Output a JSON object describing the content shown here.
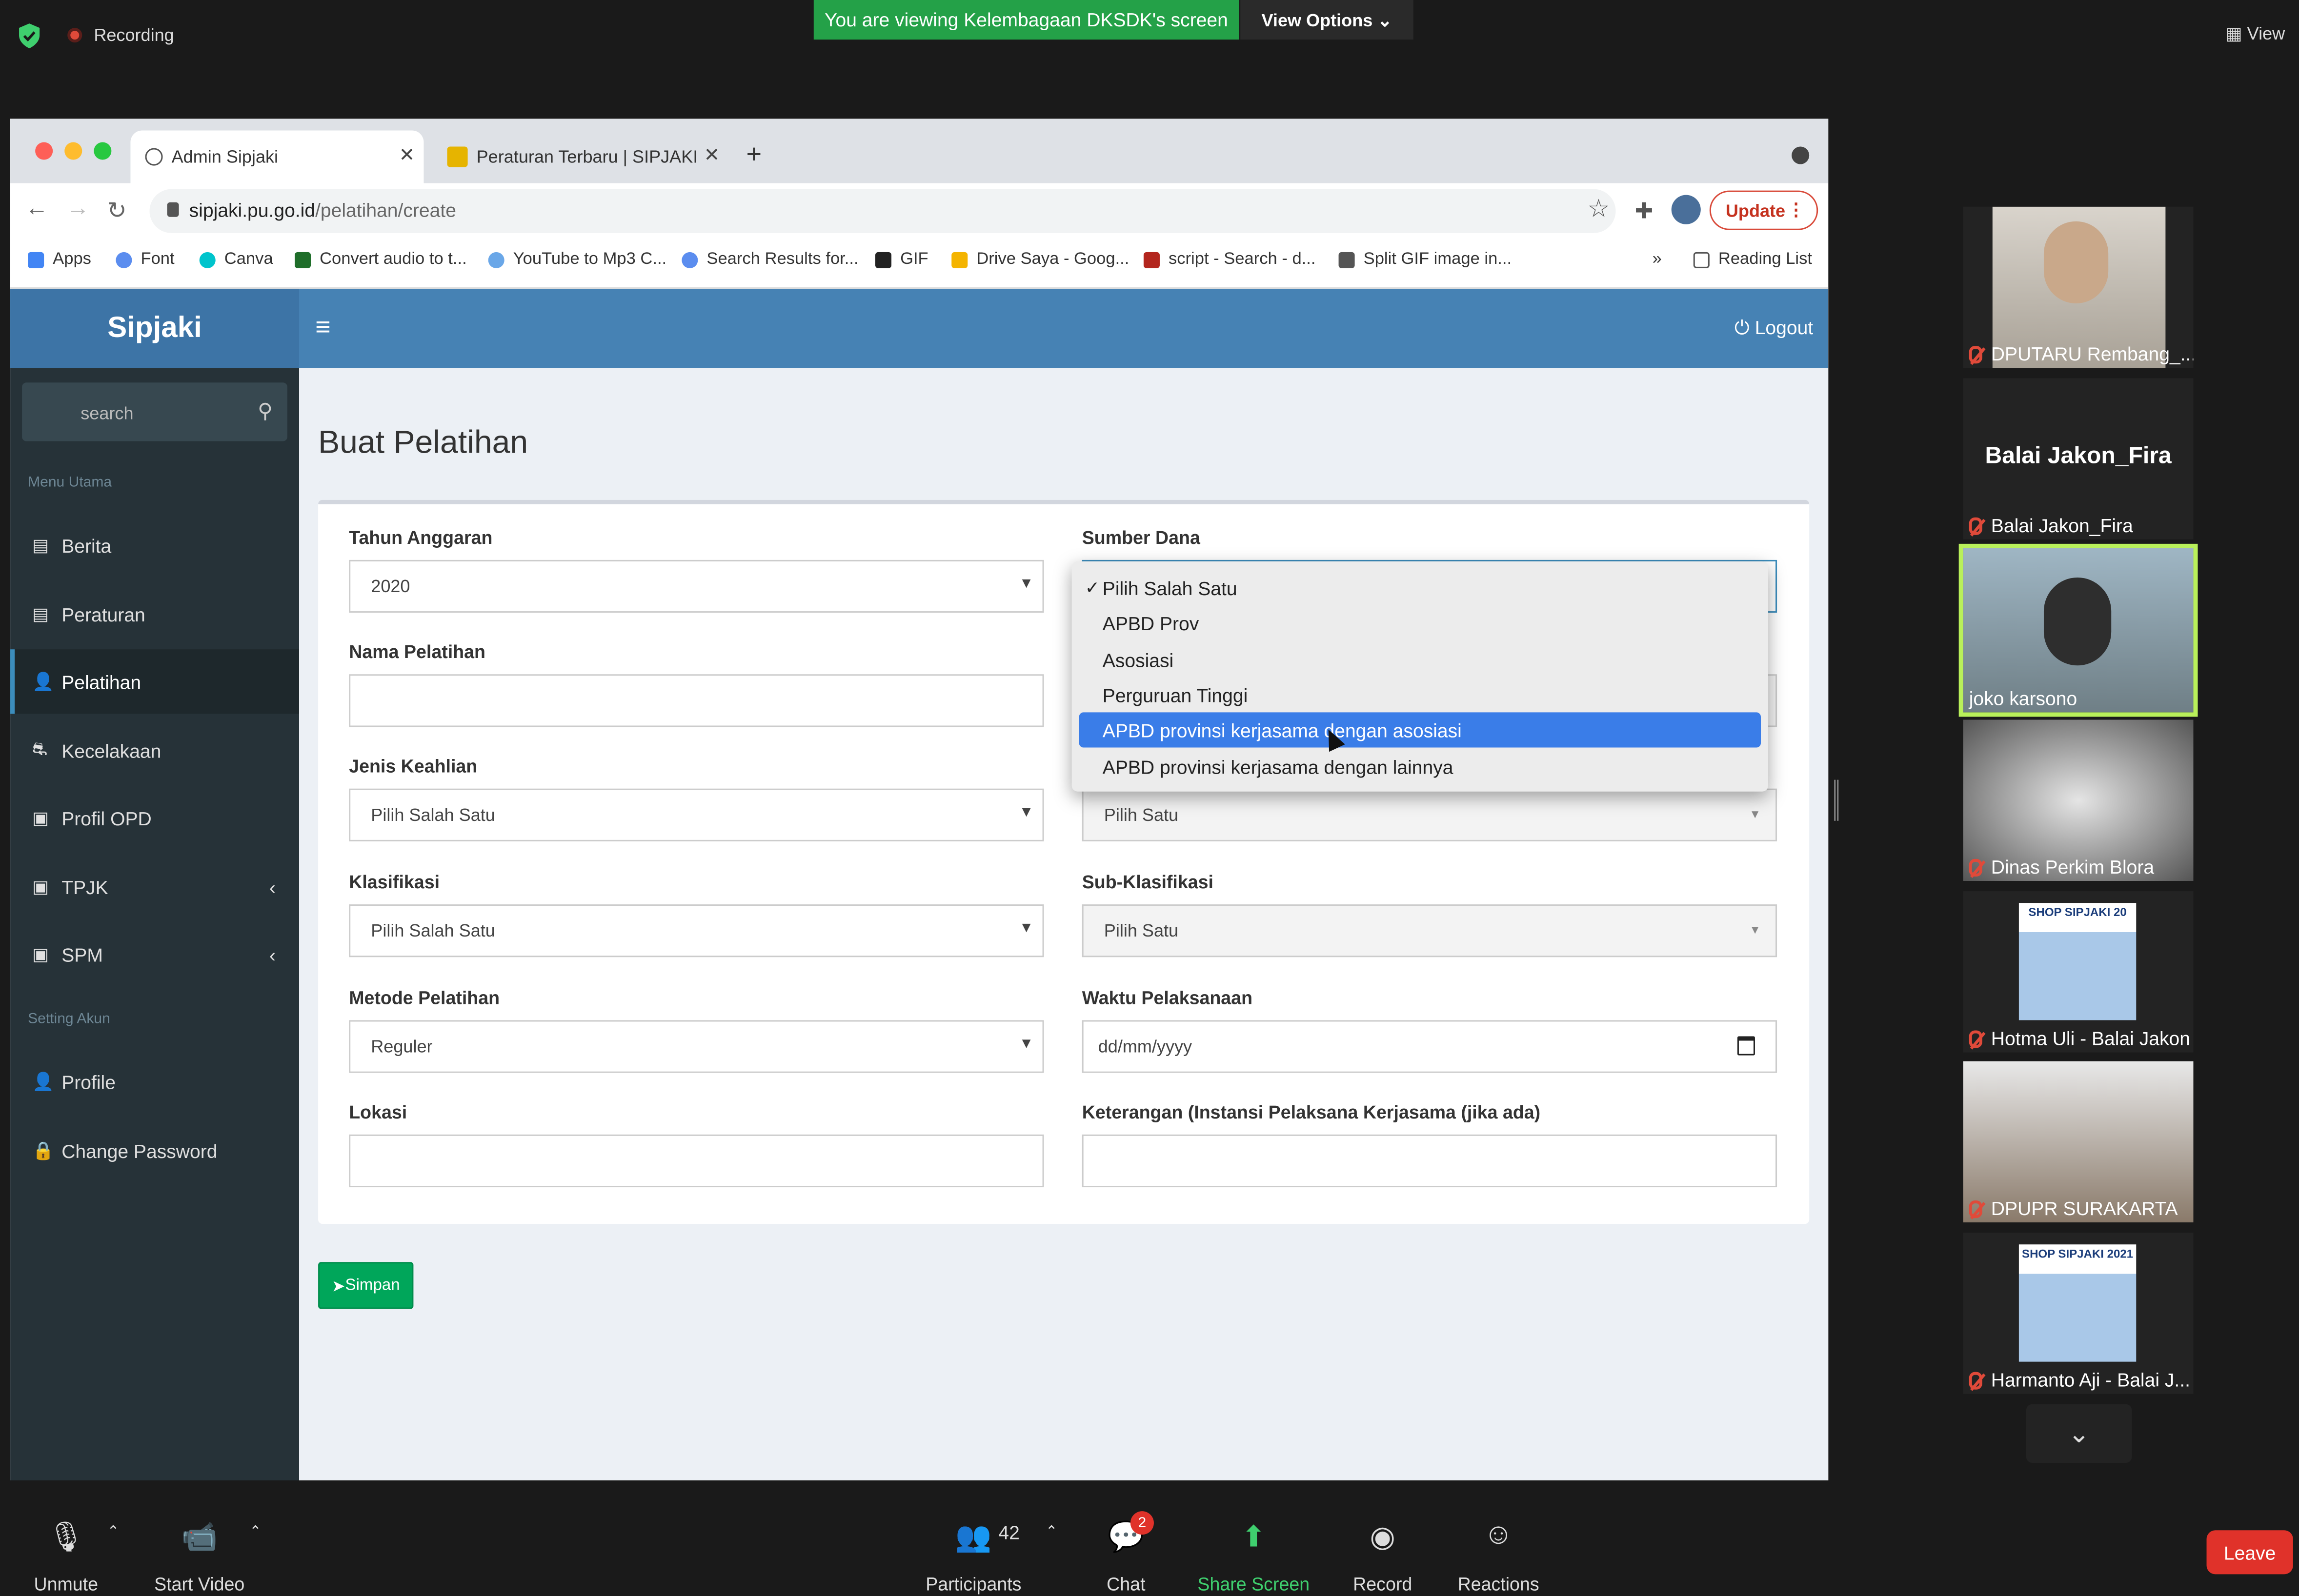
{
  "zoom": {
    "recording_label": "Recording",
    "viewing_banner": "You are viewing Kelembagaan DKSDK's screen",
    "view_options": "View Options ⌄",
    "view_label": "View",
    "participant_count": "42",
    "chat_badge": "2",
    "toolbar": {
      "unmute": "Unmute",
      "start_video": "Start Video",
      "participants": "Participants",
      "chat": "Chat",
      "share_screen": "Share Screen",
      "record": "Record",
      "reactions": "Reactions",
      "leave": "Leave"
    },
    "participants": [
      {
        "name": "DPUTARU Rembang_..."
      },
      {
        "name": "Balai Jakon_Fira",
        "big_name": "Balai Jakon_Fira"
      },
      {
        "name": "joko karsono"
      },
      {
        "name": "Dinas Perkim Blora"
      },
      {
        "name": "Hotma Uli - Balai Jakon",
        "slide": "SHOP SIPJAKI 20"
      },
      {
        "name": "DPUPR SURAKARTA"
      },
      {
        "name": "Harmanto Aji - Balai J...",
        "slide": "SHOP SIPJAKI 2021"
      }
    ]
  },
  "browser": {
    "tabs": [
      {
        "title": "Admin Sipjaki"
      },
      {
        "title": "Peraturan Terbaru | SIPJAKI"
      }
    ],
    "url_host": "sipjaki.pu.go.id",
    "url_path": "/pelatihan/create",
    "update_label": "Update",
    "bookmarks": [
      "Apps",
      "Font",
      "Canva",
      "Convert audio to t...",
      "YouTube to Mp3 C...",
      "Search Results for...",
      "GIF",
      "Drive Saya - Goog...",
      "script - Search - d...",
      "Split GIF image in..."
    ],
    "more_bookmarks": "»",
    "reading_list": "Reading List"
  },
  "app": {
    "brand": "Sipjaki",
    "logout": "Logout",
    "search_placeholder": "search",
    "menu_header_main": "Menu Utama",
    "menu_header_account": "Setting Akun",
    "menu": {
      "berita": "Berita",
      "peraturan": "Peraturan",
      "pelatihan": "Pelatihan",
      "kecelakaan": "Kecelakaan",
      "profil_opd": "Profil OPD",
      "tpjk": "TPJK",
      "spm": "SPM",
      "profile": "Profile",
      "change_password": "Change Password"
    },
    "page_title": "Buat Pelatihan",
    "form": {
      "tahun_anggaran": {
        "label": "Tahun Anggaran",
        "value": "2020"
      },
      "sumber_dana": {
        "label": "Sumber Dana"
      },
      "nama_pelatihan": {
        "label": "Nama Pelatihan",
        "value": ""
      },
      "jenis_keahlian": {
        "label": "Jenis Keahlian",
        "value": "Pilih Salah Satu"
      },
      "jenis_right": {
        "value": "Pilih Satu"
      },
      "klasifikasi": {
        "label": "Klasifikasi",
        "value": "Pilih Salah Satu"
      },
      "sub_klasifikasi": {
        "label": "Sub-Klasifikasi",
        "value": "Pilih Satu"
      },
      "metode": {
        "label": "Metode Pelatihan",
        "value": "Reguler"
      },
      "waktu": {
        "label": "Waktu Pelaksanaan",
        "value": "dd/mm/yyyy"
      },
      "lokasi": {
        "label": "Lokasi",
        "value": ""
      },
      "keterangan": {
        "label": "Keterangan (Instansi Pelaksana Kerjasama (jika ada)",
        "value": ""
      }
    },
    "dropdown_options": [
      "Pilih Salah Satu",
      "APBD Prov",
      "Asosiasi",
      "Perguruan Tinggi",
      "APBD provinsi kerjasama dengan asosiasi",
      "APBD provinsi kerjasama dengan lainnya"
    ],
    "dropdown_checked": "Pilih Salah Satu",
    "dropdown_highlighted": "APBD provinsi kerjasama dengan asosiasi",
    "save_label": "Simpan"
  }
}
